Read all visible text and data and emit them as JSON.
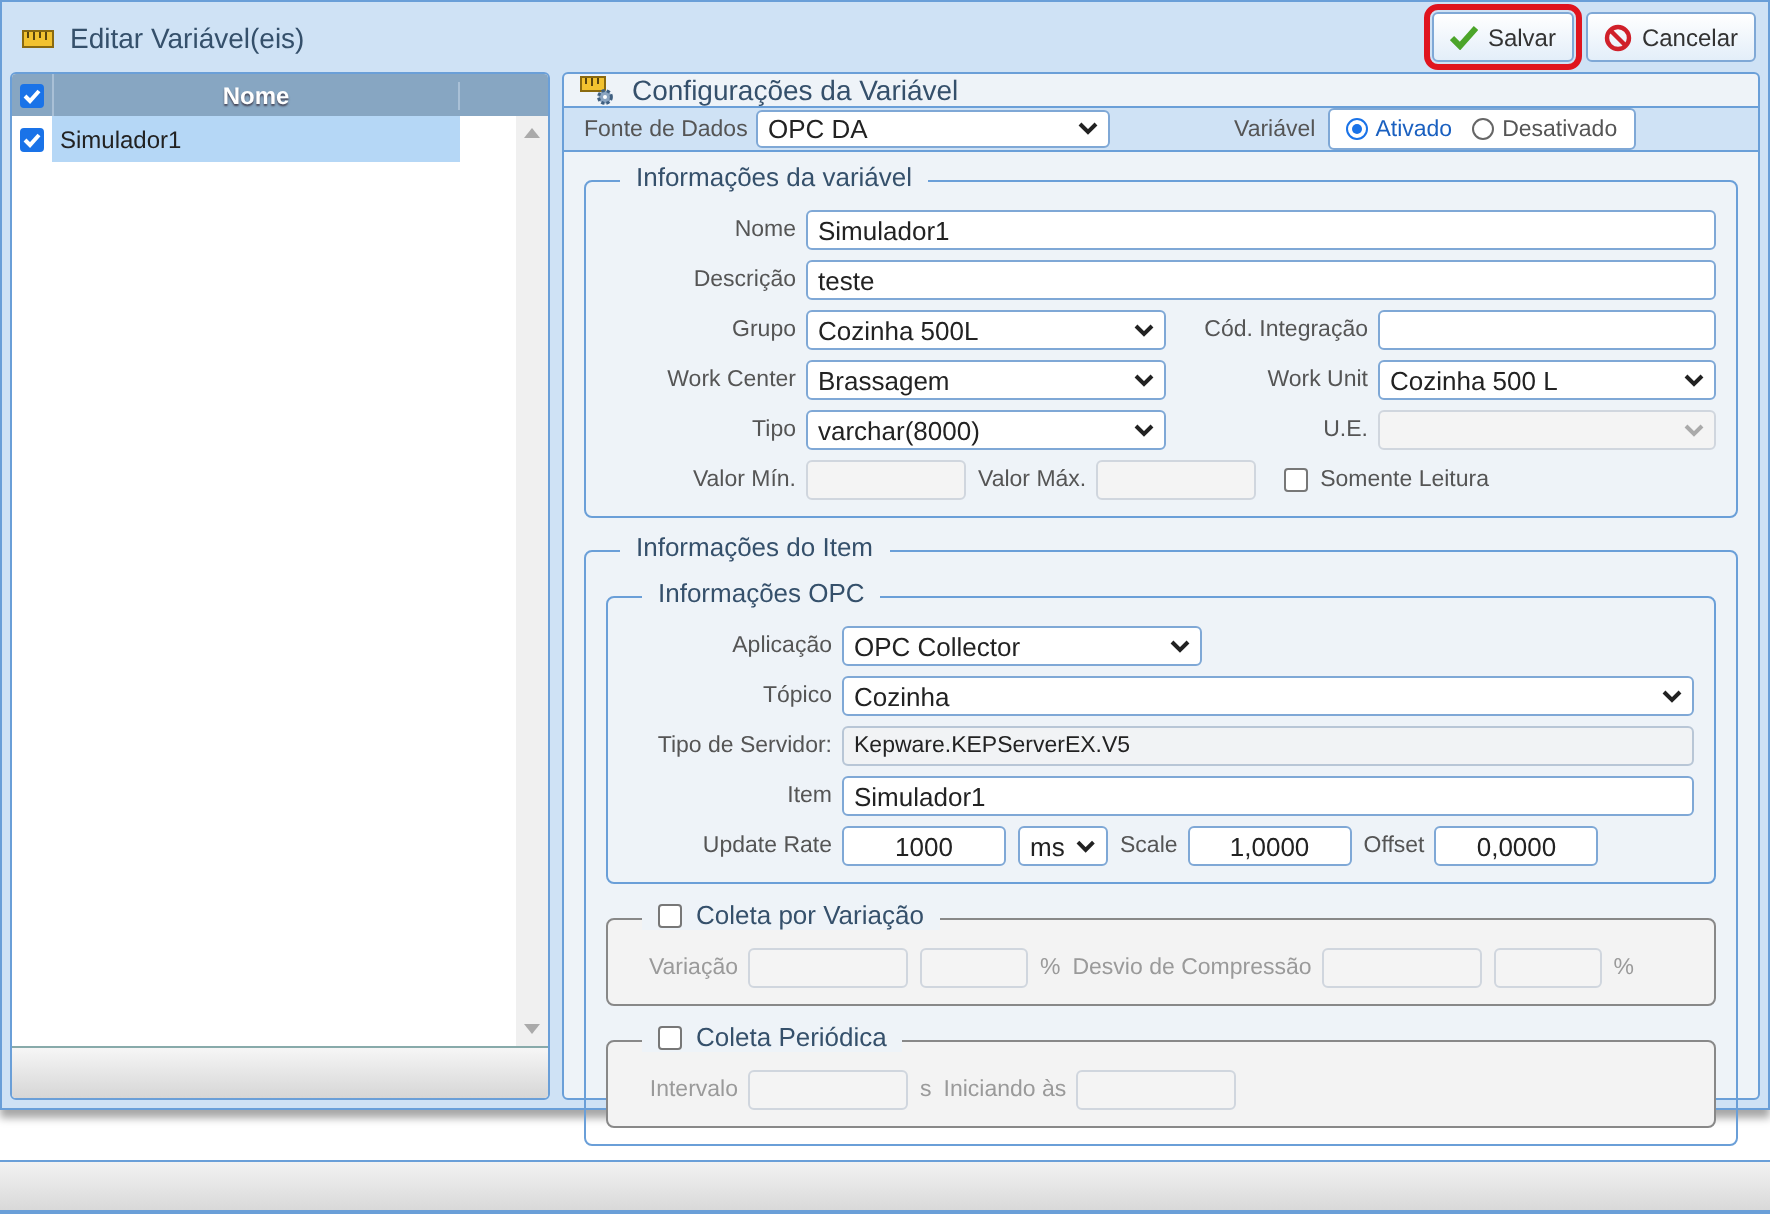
{
  "window": {
    "title": "Editar Variável(eis)"
  },
  "buttons": [
    {
      "label": "Salvar",
      "kind": "save",
      "highlighted": true
    },
    {
      "label": "Cancelar",
      "kind": "cancel",
      "highlighted": false
    }
  ],
  "list": {
    "header_checked": true,
    "column": "Nome",
    "rows": [
      {
        "label": "Simulador1",
        "checked": true,
        "selected": true
      }
    ]
  },
  "panel": {
    "title": "Configurações da Variável"
  },
  "data_source": {
    "label": "Fonte de Dados",
    "value": "OPC DA"
  },
  "variable_state": {
    "label": "Variável",
    "options": [
      {
        "label": "Ativado",
        "selected": true
      },
      {
        "label": "Desativado",
        "selected": false
      }
    ]
  },
  "variable_info": {
    "legend": "Informações da variável",
    "rows": [
      [
        {
          "kind": "text",
          "label": "Nome",
          "value": "Simulador1",
          "disabled": false
        }
      ],
      [
        {
          "kind": "text",
          "label": "Descrição",
          "value": "teste",
          "disabled": false
        }
      ],
      [
        {
          "kind": "select",
          "label": "Grupo",
          "value": "Cozinha 500L",
          "disabled": false
        },
        {
          "kind": "text",
          "label": "Cód. Integração",
          "disabled": false
        }
      ],
      [
        {
          "kind": "select",
          "label": "Work Center",
          "value": "Brassagem",
          "disabled": false
        },
        {
          "kind": "select",
          "label": "Work Unit",
          "value": "Cozinha 500 L",
          "disabled": false
        }
      ],
      [
        {
          "kind": "select",
          "label": "Tipo",
          "value": "varchar(8000)",
          "disabled": false
        },
        {
          "kind": "select",
          "label": "U.E.",
          "disabled": true
        }
      ],
      [
        {
          "kind": "number",
          "label": "Valor Mín.",
          "disabled": true
        },
        {
          "kind": "number",
          "label": "Valor Máx.",
          "disabled": true
        },
        {
          "kind": "check",
          "label": "Somente Leitura",
          "checked": false
        }
      ]
    ]
  },
  "item_info": {
    "legend": "Informações do Item",
    "opc": {
      "legend": "Informações OPC",
      "rows": [
        [
          {
            "kind": "select",
            "label": "Aplicação",
            "value": "OPC Collector",
            "disabled": false
          }
        ],
        [
          {
            "kind": "select",
            "label": "Tópico",
            "value": "Cozinha",
            "disabled": false
          }
        ],
        [
          {
            "kind": "readonly",
            "label": "Tipo de Servidor:",
            "value": "Kepware.KEPServerEX.V5"
          }
        ],
        [
          {
            "kind": "text",
            "label": "Item",
            "value": "Simulador1",
            "disabled": false
          }
        ],
        [
          {
            "kind": "number",
            "label": "Update Rate",
            "value": "1000",
            "disabled": false
          },
          {
            "kind": "select",
            "value": "ms",
            "disabled": false
          },
          {
            "kind": "number",
            "label": "Scale",
            "value": "1,0000",
            "disabled": false
          },
          {
            "kind": "number",
            "label": "Offset",
            "value": "0,0000",
            "disabled": false
          }
        ]
      ]
    },
    "variation": {
      "legend": "Coleta por Variação",
      "checked": false,
      "rows": [
        [
          {
            "kind": "number",
            "label": "Variação",
            "disabled": true
          },
          {
            "kind": "number",
            "disabled": true
          },
          {
            "kind": "unit",
            "label": "%"
          },
          {
            "kind": "number",
            "label": "Desvio de Compressão",
            "disabled": true
          },
          {
            "kind": "number",
            "disabled": true
          },
          {
            "kind": "unit",
            "label": "%"
          }
        ]
      ]
    },
    "periodic": {
      "legend": "Coleta Periódica",
      "checked": false,
      "rows": [
        [
          {
            "kind": "number",
            "label": "Intervalo",
            "disabled": true
          },
          {
            "kind": "unit",
            "label": "s"
          },
          {
            "kind": "number",
            "label": "Iniciando às",
            "disabled": true
          }
        ]
      ]
    }
  }
}
